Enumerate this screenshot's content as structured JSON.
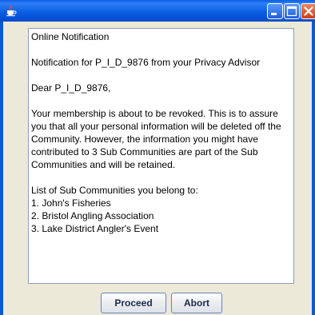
{
  "window": {
    "title": "",
    "icon": "java-cup-icon",
    "controls": [
      "minimize-icon",
      "maximize-icon",
      "close-icon"
    ]
  },
  "message": {
    "lines": [
      "Online Notification",
      "",
      "Notification for P_I_D_9876 from your Privacy Advisor",
      "",
      "Dear P_I_D_9876,",
      "",
      "Your membership is about to be revoked. This is to assure",
      "you that all your personal information will be deleted off the",
      "Community. However, the information you might have",
      "contributed to 3 Sub Communities are part of the Sub",
      "Communities and will be retained.",
      "",
      "List of Sub Communities you belong to:",
      "1. John's Fisheries",
      "2. Bristol Angling Association",
      "3. Lake District Angler's Event"
    ]
  },
  "buttons": {
    "proceed": "Proceed",
    "abort": "Abort"
  },
  "colors": {
    "titlebar": "#0a5fe6",
    "client_background": "#ece9d8",
    "close_button": "#c8401a"
  }
}
